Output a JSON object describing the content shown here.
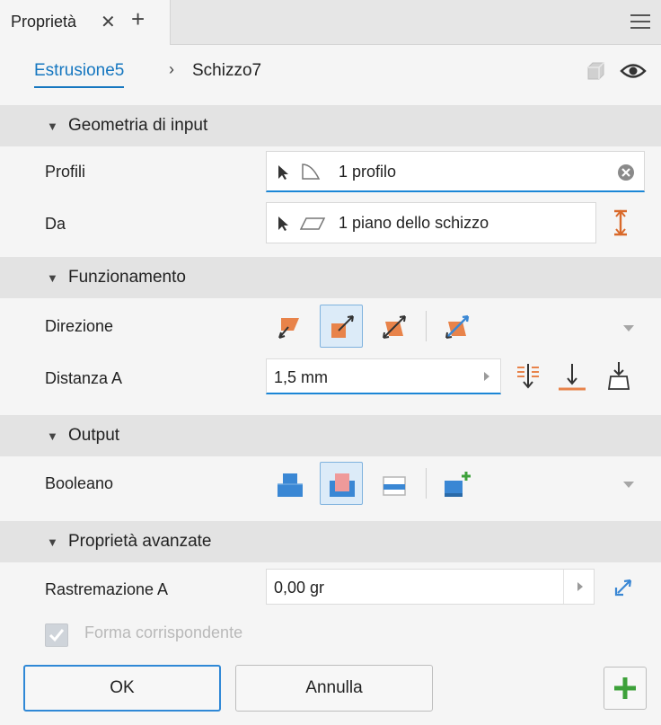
{
  "tab": {
    "title": "Proprietà",
    "close": "✕",
    "add": "+"
  },
  "breadcrumb": {
    "feature": "Estrusione5",
    "separator": "›",
    "sketch": "Schizzo7"
  },
  "sections": {
    "input_geometry": "Geometria di input",
    "operation": "Funzionamento",
    "output": "Output",
    "advanced": "Proprietà avanzate"
  },
  "input_geometry": {
    "profiles_label": "Profili",
    "profiles_value": "1 profilo",
    "from_label": "Da",
    "from_value": "1 piano dello schizzo"
  },
  "operation": {
    "direction_label": "Direzione",
    "direction_selected": "Direction 2",
    "distance_label": "Distanza A",
    "distance_value": "1,5 mm"
  },
  "output": {
    "boolean_label": "Booleano",
    "boolean_selected": "Cut"
  },
  "advanced": {
    "taper_label": "Rastremazione A",
    "taper_value": "0,00 gr",
    "match_shape_label": "Forma corrispondente",
    "match_shape_checked": true,
    "match_shape_enabled": false
  },
  "footer": {
    "ok": "OK",
    "cancel": "Annulla",
    "apply": "+"
  },
  "colors": {
    "accent": "#1677c0",
    "header_bg": "#e3e3e3",
    "icon_orange": "#e8834a",
    "icon_blue": "#3a87d4",
    "apply_green": "#3da13a"
  }
}
